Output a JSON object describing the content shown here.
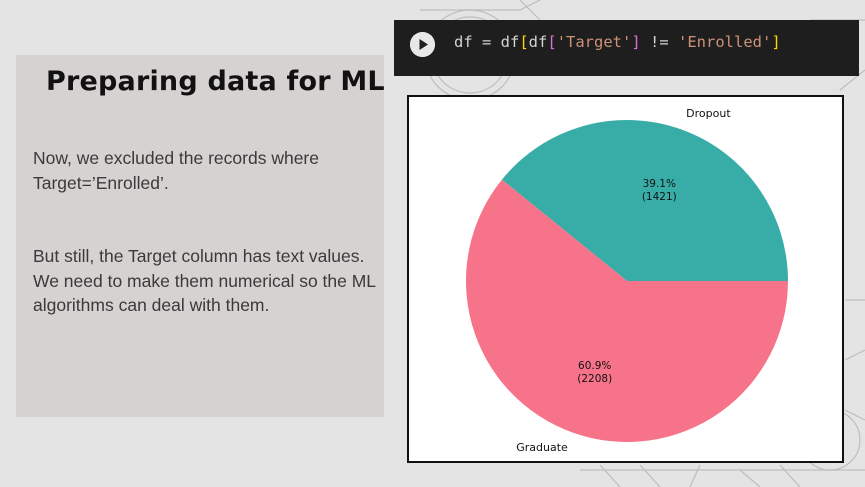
{
  "slide": {
    "title": "Preparing data for ML",
    "paragraph1": "Now, we excluded the records where Target=’Enrolled’.",
    "paragraph2": "But still, the Target column has text values. We need to make them numerical so the ML algorithms can deal with them."
  },
  "code_cell": {
    "code": "df = df[df['Target'] != 'Enrolled']",
    "run_icon": "play-icon"
  },
  "chart_data": {
    "type": "pie",
    "categories": [
      "Dropout",
      "Graduate"
    ],
    "values": [
      1421,
      2208
    ],
    "percent_labels": [
      "39.1%",
      "60.9%"
    ],
    "count_labels": [
      "(1421)",
      "(2208)"
    ],
    "colors": [
      "#38ada7",
      "#f7738a"
    ],
    "title": "",
    "legend": "none"
  }
}
